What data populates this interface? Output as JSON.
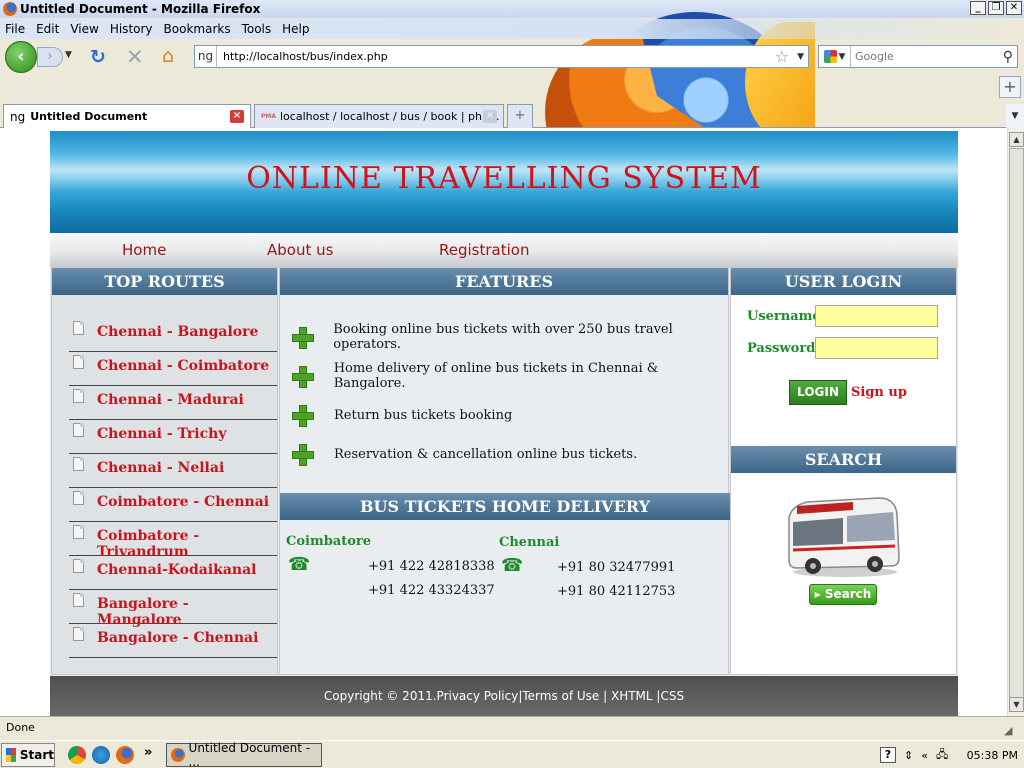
{
  "window": {
    "title": "Untitled Document - Mozilla Firefox",
    "controls": {
      "minimize": "_",
      "maximize": "❐",
      "close": "✕"
    }
  },
  "menu": [
    "File",
    "Edit",
    "View",
    "History",
    "Bookmarks",
    "Tools",
    "Help"
  ],
  "toolbar": {
    "url": "http://localhost/bus/index.php",
    "url_site_icon": "ng",
    "search_placeholder": "Google"
  },
  "tabs": [
    {
      "icon": "ng",
      "label": "Untitled Document",
      "active": true
    },
    {
      "icon": "PMA",
      "label": "localhost / localhost / bus / book | php...",
      "active": false
    }
  ],
  "site": {
    "title": "ONLINE TRAVELLING SYSTEM",
    "nav": [
      "Home",
      "About us",
      "Registration"
    ],
    "top_routes": {
      "heading": "TOP ROUTES",
      "items": [
        "Chennai - Bangalore",
        "Chennai - Coimbatore",
        "Chennai - Madurai",
        "Chennai - Trichy",
        "Chennai - Nellai",
        "Coimbatore - Chennai",
        "Coimbatore - Trivandrum",
        "Chennai-Kodaikanal",
        "Bangalore - Mangalore",
        "Bangalore - Chennai"
      ]
    },
    "features": {
      "heading": "FEATURES",
      "items": [
        "Booking online bus tickets with over 250 bus travel operators.",
        "Home delivery of online bus tickets in Chennai & Bangalore.",
        "Return bus tickets booking",
        "Reservation & cancellation online bus tickets."
      ]
    },
    "delivery": {
      "heading": "BUS TICKETS HOME DELIVERY",
      "cities": [
        {
          "name": "Coimbatore",
          "phones": [
            "+91 422 42818338",
            "+91 422 43324337"
          ]
        },
        {
          "name": "Chennai",
          "phones": [
            "+91 80 32477991",
            "+91 80 42112753"
          ]
        }
      ]
    },
    "login": {
      "heading": "USER LOGIN",
      "username_label": "Username",
      "password_label": "Password",
      "login_button": "LOGIN",
      "signup_link": "Sign up"
    },
    "search": {
      "heading": "SEARCH",
      "button": "Search"
    },
    "footer": "Copyright © 2011.Privacy Policy|Terms of Use | XHTML |CSS"
  },
  "status": "Done",
  "taskbar": {
    "start": "Start",
    "task_item": "Untitled Document - ...",
    "chevron": "»",
    "tray_chevron": "«",
    "clock": "05:38 PM"
  },
  "colors": {
    "site_title": "#d0131a",
    "nav_link": "#9b1414",
    "route_link": "#c8141a",
    "label_green": "#218a2a",
    "input_yellow": "#ffff9e"
  }
}
